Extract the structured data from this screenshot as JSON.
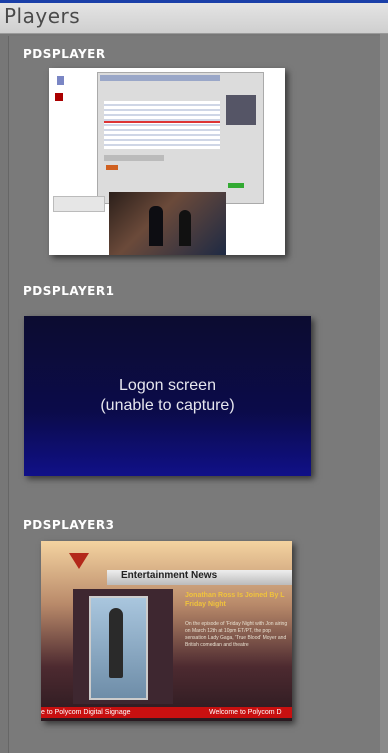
{
  "panel": {
    "title": "Players"
  },
  "players": [
    {
      "name": "PDSPLAYER"
    },
    {
      "name": "PDSPLAYER1",
      "screen_message_line1": "Logon screen",
      "screen_message_line2": "(unable to capture)"
    },
    {
      "name": "PDSPLAYER3",
      "screen": {
        "banner": "Entertainment News",
        "headline": "Jonathan Ross Is Joined By L Friday Night",
        "body": "On the episode of 'Friday Night with Jon airing on March 12th at 10pm ET/PT, the pop sensation Lady Gaga, 'True Blood' Moyer and British comedian and theatre",
        "ticker_left": "e to Polycom Digital Signage",
        "ticker_right": "Welcome to Polycom D"
      }
    }
  ]
}
